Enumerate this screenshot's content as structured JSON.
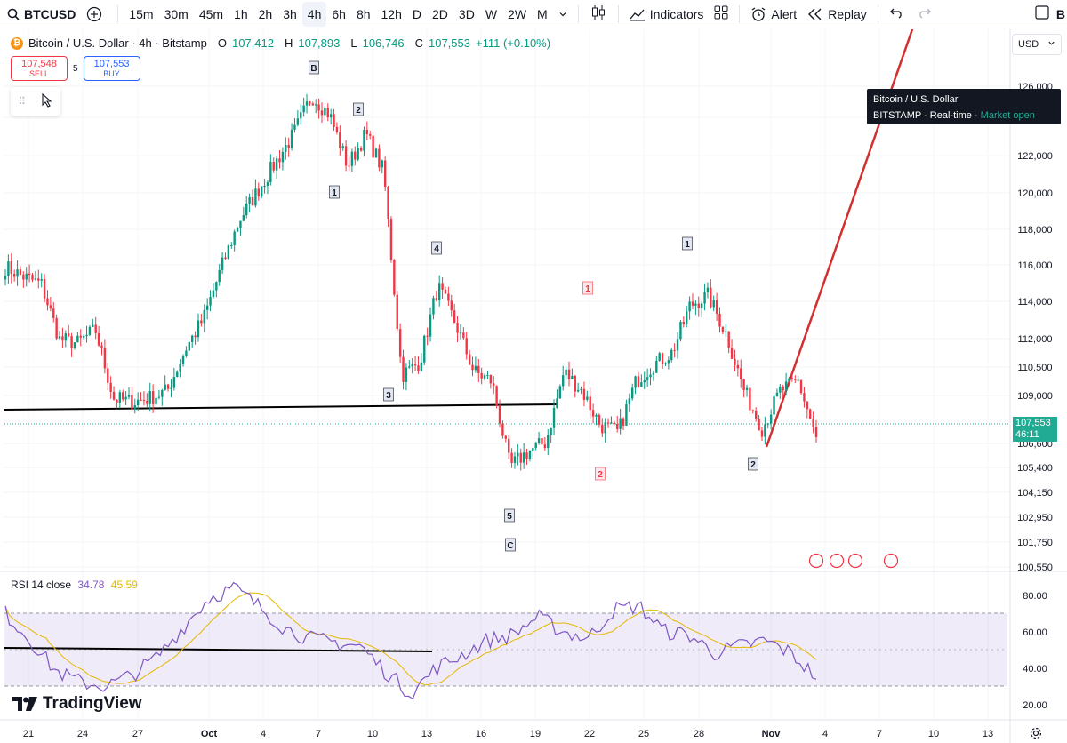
{
  "toolbar": {
    "symbol": "BTCUSD",
    "intervals": [
      "15m",
      "30m",
      "45m",
      "1h",
      "2h",
      "3h",
      "4h",
      "6h",
      "8h",
      "12h",
      "D",
      "2D",
      "3D",
      "W",
      "2W",
      "M"
    ],
    "active_interval": "4h",
    "indicators_label": "Indicators",
    "alert_label": "Alert",
    "replay_label": "Replay",
    "corner_label": "B"
  },
  "legend": {
    "title": "Bitcoin / U.S. Dollar · 4h · Bitstamp",
    "o_label": "O",
    "o": "107,412",
    "h_label": "H",
    "h": "107,893",
    "l_label": "L",
    "l": "106,746",
    "c_label": "C",
    "c": "107,553",
    "change": "+111 (+0.10%)"
  },
  "trade": {
    "sell_price": "107,548",
    "sell_label": "SELL",
    "spread": "5",
    "buy_price": "107,553",
    "buy_label": "BUY"
  },
  "tooltip": {
    "title": "Bitcoin / U.S. Dollar",
    "exchange": "BITSTAMP",
    "feed": "Real-time",
    "status": "Market open"
  },
  "currency": "USD",
  "price_axis": [
    "126,000",
    "124,000",
    "122,000",
    "120,000",
    "118,000",
    "116,000",
    "114,000",
    "112,000",
    "110,500",
    "109,000",
    "107,800",
    "106,600",
    "105,400",
    "104,150",
    "102,950",
    "101,750",
    "100,550"
  ],
  "last_price": "107,553",
  "countdown": "46:11",
  "rsi": {
    "name": "RSI 14 close",
    "value": "34.78",
    "ma": "45.59",
    "axis": [
      "80.00",
      "60.00",
      "40.00",
      "20.00"
    ]
  },
  "brand": "TradingView",
  "wave_labels": [
    "B",
    "2",
    "1",
    "4",
    "3",
    "5",
    "C",
    "1",
    "2",
    "1",
    "2"
  ],
  "time_axis": [
    "21",
    "24",
    "27",
    "Oct",
    "4",
    "7",
    "10",
    "13",
    "16",
    "19",
    "22",
    "25",
    "28",
    "Nov",
    "4",
    "7",
    "10",
    "13"
  ],
  "colors": {
    "up": "#089981",
    "down": "#f23645",
    "rsi_line": "#7e57c2",
    "rsi_ma": "#e6b800",
    "accent": "#2962ff",
    "last_price": "#22ab94"
  },
  "chart_data": {
    "type": "candlestick",
    "symbol": "BTCUSD",
    "interval": "4h",
    "ylim": [
      100550,
      126500
    ],
    "close_path": [
      {
        "t": "Sep 19",
        "p": 116500
      },
      {
        "t": "Sep 20",
        "p": 116000
      },
      {
        "t": "Sep 21",
        "p": 115600
      },
      {
        "t": "Sep 22",
        "p": 112700
      },
      {
        "t": "Sep 23",
        "p": 112500
      },
      {
        "t": "Sep 24",
        "p": 113200
      },
      {
        "t": "Sep 25",
        "p": 109600
      },
      {
        "t": "Sep 26",
        "p": 109400
      },
      {
        "t": "Sep 27",
        "p": 109600
      },
      {
        "t": "Sep 28",
        "p": 110000
      },
      {
        "t": "Sep 29",
        "p": 112200
      },
      {
        "t": "Sep 30",
        "p": 113800
      },
      {
        "t": "Oct 1",
        "p": 116500
      },
      {
        "t": "Oct 2",
        "p": 119000
      },
      {
        "t": "Oct 3",
        "p": 120500
      },
      {
        "t": "Oct 4",
        "p": 122000
      },
      {
        "t": "Oct 5",
        "p": 123500
      },
      {
        "t": "Oct 6",
        "p": 125500
      },
      {
        "t": "Oct 7",
        "p": 124500
      },
      {
        "t": "Oct 8",
        "p": 121800
      },
      {
        "t": "Oct 9",
        "p": 123500
      },
      {
        "t": "Oct 10",
        "p": 121500
      },
      {
        "t": "Oct 11",
        "p": 110800
      },
      {
        "t": "Oct 12",
        "p": 111500
      },
      {
        "t": "Oct 13",
        "p": 115500
      },
      {
        "t": "Oct 14",
        "p": 113500
      },
      {
        "t": "Oct 15",
        "p": 111000
      },
      {
        "t": "Oct 16",
        "p": 110500
      },
      {
        "t": "Oct 17",
        "p": 106000
      },
      {
        "t": "Oct 18",
        "p": 106800
      },
      {
        "t": "Oct 19",
        "p": 107300
      },
      {
        "t": "Oct 20",
        "p": 111000
      },
      {
        "t": "Oct 21",
        "p": 110000
      },
      {
        "t": "Oct 22",
        "p": 108200
      },
      {
        "t": "Oct 23",
        "p": 107800
      },
      {
        "t": "Oct 24",
        "p": 110500
      },
      {
        "t": "Oct 25",
        "p": 111400
      },
      {
        "t": "Oct 26",
        "p": 112000
      },
      {
        "t": "Oct 27",
        "p": 114500
      },
      {
        "t": "Oct 28",
        "p": 115000
      },
      {
        "t": "Oct 29",
        "p": 113000
      },
      {
        "t": "Oct 30",
        "p": 110000
      },
      {
        "t": "Oct 31",
        "p": 108000
      },
      {
        "t": "Nov 1",
        "p": 110000
      },
      {
        "t": "Nov 2",
        "p": 110500
      },
      {
        "t": "Nov 3",
        "p": 107553
      }
    ],
    "rsi_series": [
      70,
      55,
      38,
      32,
      30,
      36,
      46,
      62,
      78,
      84,
      74,
      62,
      56,
      54,
      52,
      38,
      26,
      40,
      47,
      55,
      58,
      68,
      60,
      56,
      72,
      74,
      60,
      58,
      48,
      52,
      55,
      48,
      35
    ]
  }
}
